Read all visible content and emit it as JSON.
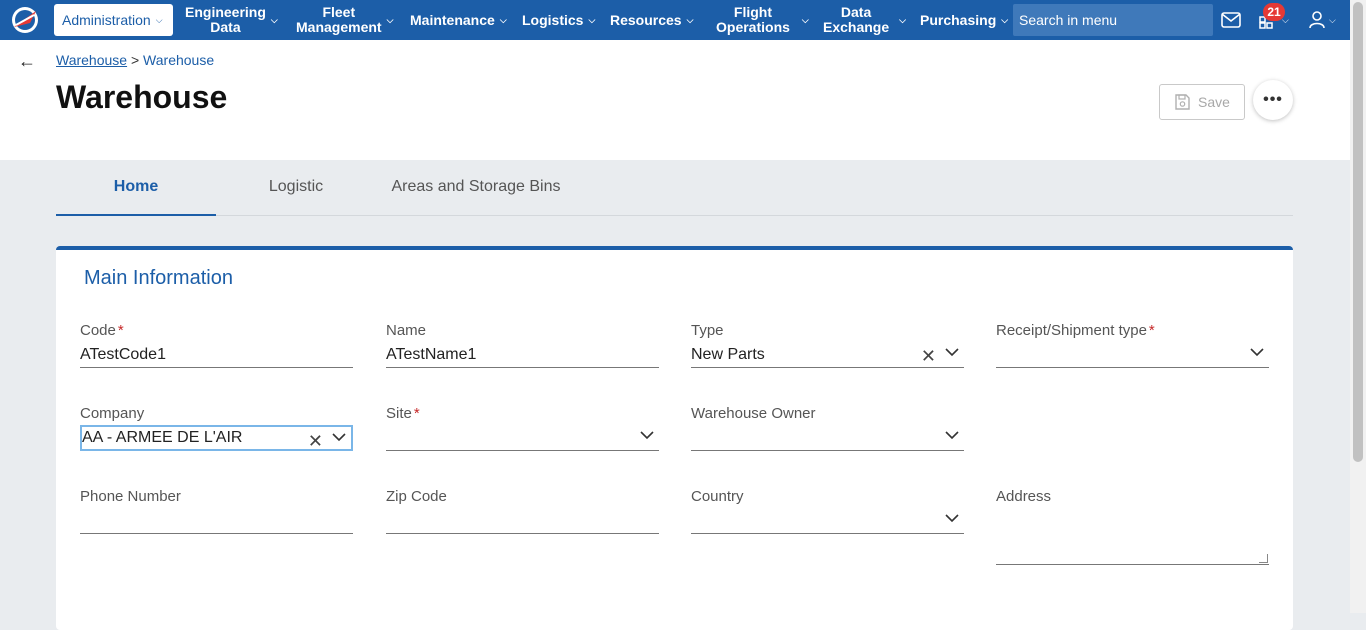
{
  "nav": {
    "items": [
      {
        "label": "Administration"
      },
      {
        "label": "Engineering\nData"
      },
      {
        "label": "Fleet\nManagement"
      },
      {
        "label": "Maintenance"
      },
      {
        "label": "Logistics"
      },
      {
        "label": "Resources"
      },
      {
        "label": "Flight\nOperations"
      },
      {
        "label": "Data\nExchange"
      },
      {
        "label": "Purchasing"
      }
    ],
    "search_placeholder": "Search in menu",
    "notifications_count": "21"
  },
  "breadcrumb": {
    "parent": "Warehouse",
    "separator": ">",
    "current": "Warehouse"
  },
  "page": {
    "title": "Warehouse",
    "save_label": "Save",
    "more_label": "•••"
  },
  "tabs": [
    {
      "label": "Home",
      "active": true
    },
    {
      "label": "Logistic",
      "active": false
    },
    {
      "label": "Areas and Storage Bins",
      "active": false
    }
  ],
  "section": {
    "title": "Main Information",
    "fields": {
      "code": {
        "label": "Code",
        "value": "ATestCode1",
        "required": true
      },
      "name": {
        "label": "Name",
        "value": "ATestName1"
      },
      "type": {
        "label": "Type",
        "value": "New Parts"
      },
      "receipt": {
        "label": "Receipt/Shipment type",
        "value": "",
        "required": true
      },
      "company": {
        "label": "Company",
        "value": "AA - ARMEE DE L'AIR"
      },
      "site": {
        "label": "Site",
        "value": "",
        "required": true
      },
      "owner": {
        "label": "Warehouse Owner",
        "value": ""
      },
      "phone": {
        "label": "Phone Number",
        "value": ""
      },
      "zip": {
        "label": "Zip Code",
        "value": ""
      },
      "country": {
        "label": "Country",
        "value": ""
      },
      "address": {
        "label": "Address",
        "value": ""
      }
    }
  },
  "colors": {
    "accent": "#1c5ea8",
    "required": "#c62828",
    "badge": "#e53935"
  }
}
